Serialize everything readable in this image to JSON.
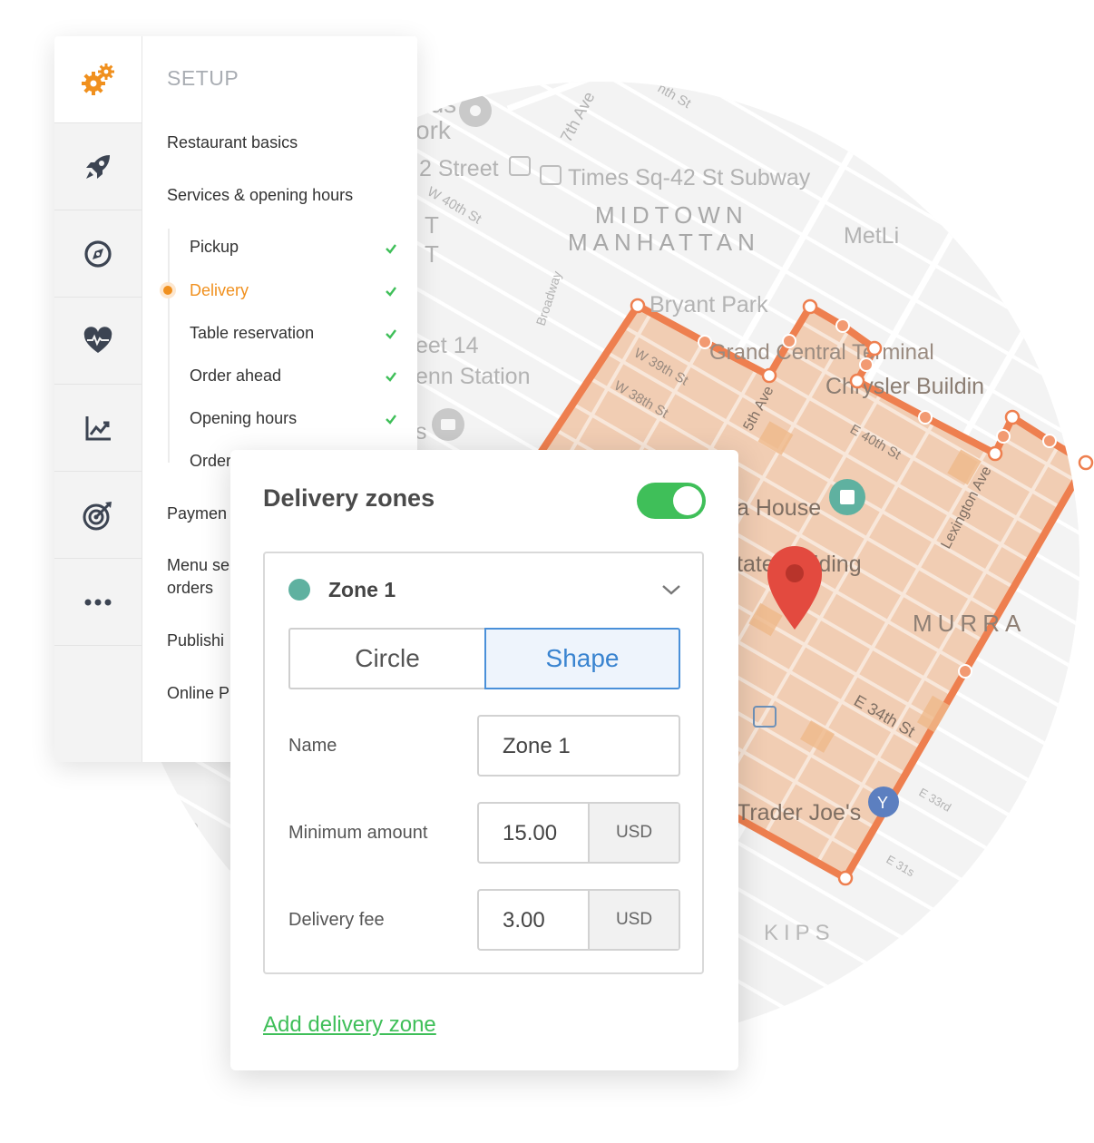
{
  "map": {
    "labels": {
      "l1": "uds",
      "l2": "ork",
      "l3": "2 Street",
      "l4": "Times Sq-42 St Subway",
      "l5": "7th Ave",
      "l6": "W 40th St",
      "l7": "MIDTOWN",
      "l8": "MANHATTAN",
      "l9": "MetLi",
      "l10": "Bryant Park",
      "l11": "eet 14",
      "l12": "enn Station",
      "l13": "Broadway",
      "l14": "W 39th St",
      "l15": "W 38th St",
      "l16": "5th Ave",
      "l17": "Grand Central Terminal",
      "l18": "Chrysler Buildin",
      "l19": "E 40th St",
      "l20": "Lexington Ave",
      "l21": "a House",
      "l22": "tate Building",
      "l23": "MURRA",
      "l24": "E 34th St",
      "l25": "Trader Joe's",
      "l26": "E 33rd",
      "l27": "E 31s",
      "l28": "KIPS",
      "l29": "eet",
      "l30": "3rd",
      "l31": "St",
      "l32": "nth St",
      "l33": "T",
      "l34": "T",
      "l35": "s"
    }
  },
  "setup": {
    "title": "SETUP",
    "rail": [
      "gears-icon",
      "rocket-icon",
      "compass-icon",
      "heart-pulse-icon",
      "chart-icon",
      "target-icon",
      "more-icon"
    ],
    "menu": {
      "restaurant_basics": "Restaurant basics",
      "services": "Services & opening hours",
      "payments": "Paymen",
      "menu_setup_1": "Menu se",
      "menu_setup_2": "orders",
      "publishing": "Publishi",
      "online": "Online P"
    },
    "sub_items": {
      "pickup": "Pickup",
      "delivery": "Delivery",
      "table_reservation": "Table reservation",
      "order_ahead": "Order ahead",
      "opening_hours": "Opening hours",
      "order_partial": "Order"
    }
  },
  "delivery": {
    "title": "Delivery zones",
    "enabled": true,
    "zone": {
      "name": "Zone 1",
      "color": "#5fb1a0",
      "mode_circle": "Circle",
      "mode_shape": "Shape",
      "selected_mode": "Shape",
      "name_label": "Name",
      "name_value": "Zone 1",
      "min_label": "Minimum amount",
      "min_value": "15.00",
      "min_unit": "USD",
      "fee_label": "Delivery fee",
      "fee_value": "3.00",
      "fee_unit": "USD"
    },
    "add_label": "Add delivery zone"
  },
  "colors": {
    "accent_orange": "#f0901e",
    "toggle_green": "#3fbf59",
    "zone_stroke": "#ee7f4f",
    "selected_blue": "#4a90d9"
  }
}
